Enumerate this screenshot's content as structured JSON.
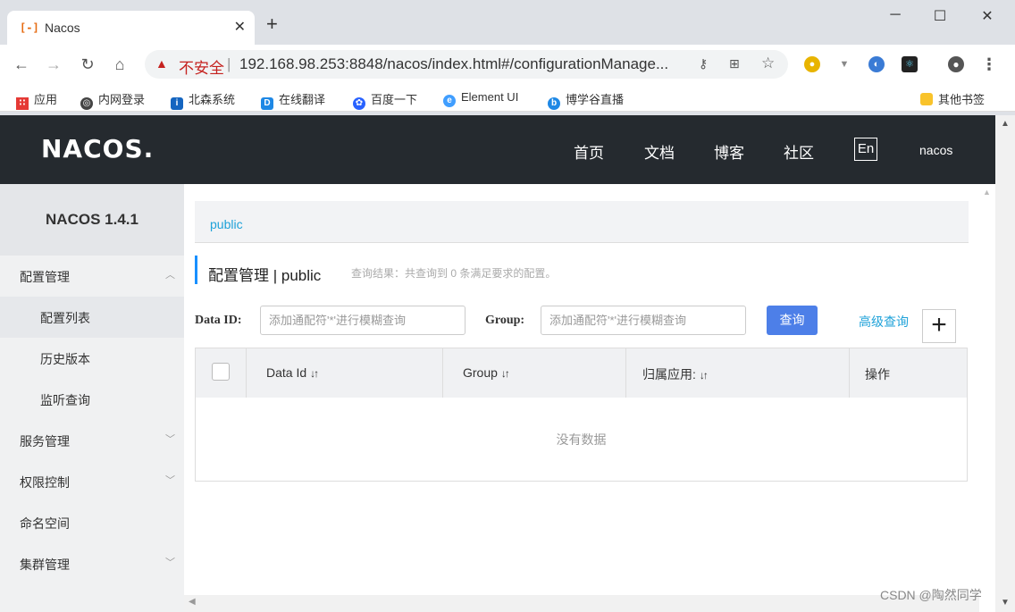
{
  "browser": {
    "tab_title": "Nacos",
    "tab_favicon": "[-]",
    "url_warning": "不安全",
    "url": "192.168.98.253:8848/nacos/index.html#/configurationManage...",
    "bookmarks": [
      "应用",
      "内网登录",
      "北森系统",
      "在线翻译",
      "百度一下",
      "Element UI",
      "博学谷直播"
    ],
    "other_bookmarks": "其他书签"
  },
  "header": {
    "logo": "NACOS.",
    "nav": [
      "首页",
      "文档",
      "博客",
      "社区"
    ],
    "lang": "En",
    "user": "nacos"
  },
  "sidebar": {
    "title": "NACOS 1.4.1",
    "items": [
      {
        "label": "配置管理"
      },
      {
        "label": "配置列表"
      },
      {
        "label": "历史版本"
      },
      {
        "label": "监听查询"
      },
      {
        "label": "服务管理"
      },
      {
        "label": "权限控制"
      },
      {
        "label": "命名空间"
      },
      {
        "label": "集群管理"
      }
    ]
  },
  "main": {
    "breadcrumb": "public",
    "title": "配置管理 | public",
    "result_text": "查询结果：共查询到 0 条满足要求的配置。",
    "data_id_label": "Data ID:",
    "data_id_placeholder": "添加通配符'*'进行模糊查询",
    "group_label": "Group:",
    "group_placeholder": "添加通配符'*'进行模糊查询",
    "query_button": "查询",
    "advanced_query": "高级查询",
    "add_button": "+",
    "table": {
      "columns": [
        "Data Id",
        "Group",
        "归属应用:",
        "操作"
      ],
      "empty_text": "没有数据"
    }
  },
  "watermark": "CSDN @陶然同学"
}
